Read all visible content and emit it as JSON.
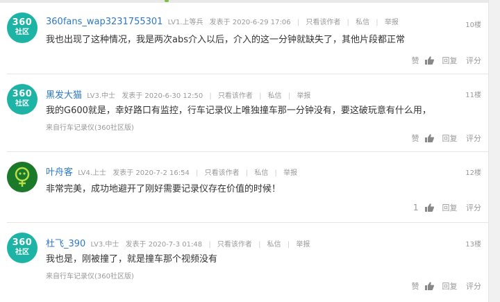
{
  "posts": [
    {
      "avatar": {
        "line1": "360",
        "line2": "社区"
      },
      "username": "360fans_wap3231755301",
      "level": "LV1.上等兵",
      "posted": "发表于 2020-6-29 17:06",
      "only_author": "只看该作者",
      "message": "私信",
      "report": "举报",
      "floor": "10楼",
      "content": "我也出现了这种情况，我是两次abs介入以后，介入的这一分钟就缺失了，其他片段都正常",
      "source": "",
      "like_count": "",
      "like_label": "赞",
      "reply_label": "回复",
      "rate_label": "评分"
    },
    {
      "avatar": {
        "line1": "360",
        "line2": "社区"
      },
      "username": "黑发大猫",
      "level": "LV3.中士",
      "posted": "发表于 2020-6-30 12:50",
      "only_author": "只看该作者",
      "message": "私信",
      "report": "举报",
      "floor": "11楼",
      "content": "我的G600就是，幸好路口有监控，行车记录仪上唯独撞车那一分钟没有，要这破玩意有什么用，",
      "source": "来自行车记录仪(360社区版)",
      "like_count": "",
      "like_label": "赞",
      "reply_label": "回复",
      "rate_label": "评分"
    },
    {
      "avatar": {
        "line1": "",
        "line2": ""
      },
      "username": "叶舟客",
      "level": "LV4.上士",
      "posted": "发表于 2020-7-2 16:54",
      "only_author": "只看该作者",
      "message": "私信",
      "report": "举报",
      "floor": "12楼",
      "content": "非常完美，成功地避开了刚好需要记录仪存在价值的时候！",
      "source": "",
      "like_count": "1",
      "like_label": "",
      "reply_label": "回复",
      "rate_label": "评分"
    },
    {
      "avatar": {
        "line1": "360",
        "line2": "社区"
      },
      "username": "杜飞_390",
      "level": "LV3.中士",
      "posted": "发表于 2020-7-3 01:48",
      "only_author": "只看该作者",
      "message": "私信",
      "report": "举报",
      "floor": "13楼",
      "content": "我也是，刚被撞了，就是撞车那个视频没有",
      "source": "来自行车记录仪(360社区版)",
      "like_count": "",
      "like_label": "赞",
      "reply_label": "回复",
      "rate_label": "评分"
    }
  ],
  "colors": {
    "username": "#2d78c8",
    "avatar_teal": "#1db3a5",
    "avatar_green": "#1a7a2a"
  }
}
